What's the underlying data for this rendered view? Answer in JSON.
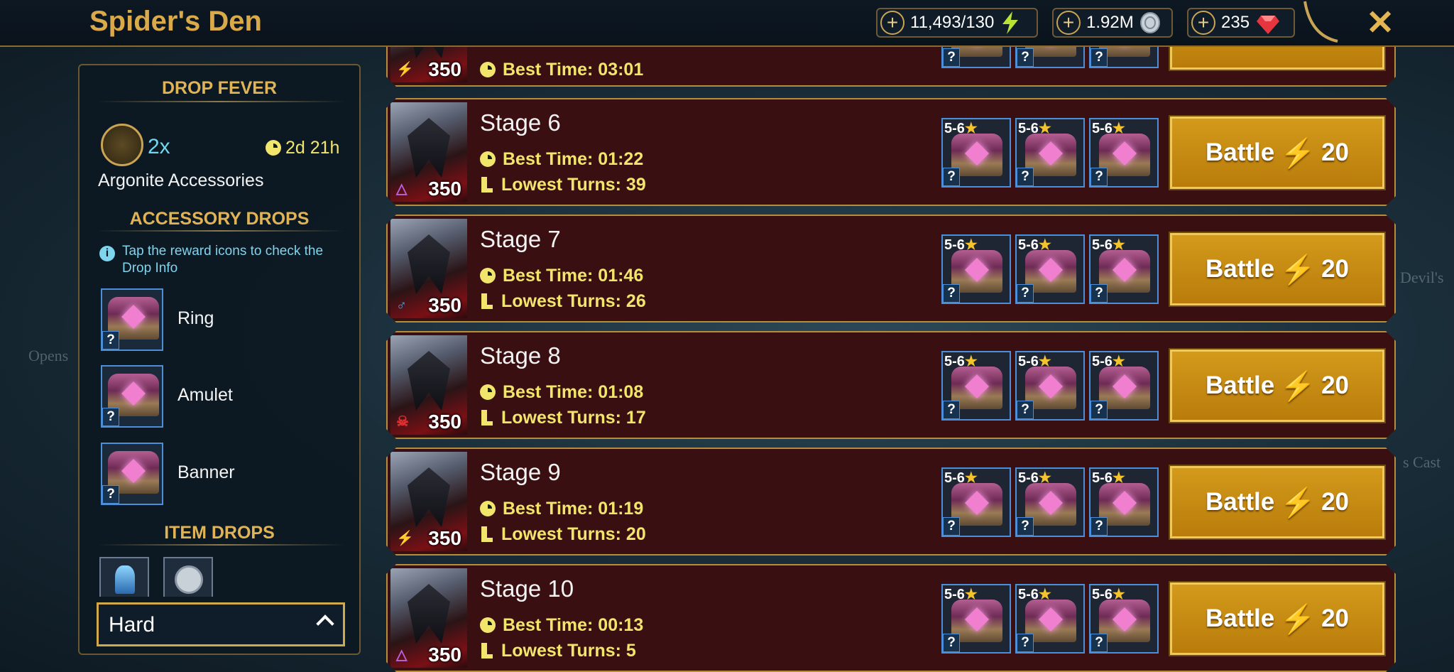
{
  "header": {
    "title": "Spider's Den",
    "energy": "11,493/130",
    "silver": "1.92M",
    "gems": "235",
    "close_icon": "close-icon"
  },
  "left_panel": {
    "drop_fever_title": "DROP FEVER",
    "multiplier": "2x",
    "timer": "2d 21h",
    "fever_item": "Argonite Accessories",
    "accessory_drops_title": "ACCESSORY DROPS",
    "info_text": "Tap the reward icons to check the Drop Info",
    "accessories": [
      {
        "name": "Ring",
        "q": "?"
      },
      {
        "name": "Amulet",
        "q": "?"
      },
      {
        "name": "Banner",
        "q": "?"
      }
    ],
    "item_drops_title": "ITEM DROPS",
    "difficulty": "Hard"
  },
  "stages": [
    {
      "name": "",
      "best_time": "Best Time: 03:01",
      "lowest_turns": "",
      "level": "350",
      "affinity": "⚡",
      "affinity_color": "#5fd35f"
    },
    {
      "name": "Stage 6",
      "best_time": "Best Time: 01:22",
      "lowest_turns": "Lowest Turns: 39",
      "level": "350",
      "affinity": "△",
      "affinity_color": "#c060e0"
    },
    {
      "name": "Stage 7",
      "best_time": "Best Time: 01:46",
      "lowest_turns": "Lowest Turns: 26",
      "level": "350",
      "affinity": "♂",
      "affinity_color": "#4aa0f0"
    },
    {
      "name": "Stage 8",
      "best_time": "Best Time: 01:08",
      "lowest_turns": "Lowest Turns: 17",
      "level": "350",
      "affinity": "☠",
      "affinity_color": "#e03030"
    },
    {
      "name": "Stage 9",
      "best_time": "Best Time: 01:19",
      "lowest_turns": "Lowest Turns: 20",
      "level": "350",
      "affinity": "⚡",
      "affinity_color": "#5fd35f"
    },
    {
      "name": "Stage 10",
      "best_time": "Best Time: 00:13",
      "lowest_turns": "Lowest Turns: 5",
      "level": "350",
      "affinity": "△",
      "affinity_color": "#c060e0"
    }
  ],
  "reward": {
    "rank": "5-6",
    "star": "★",
    "q": "?"
  },
  "battle": {
    "label": "Battle",
    "bolt": "⚡",
    "cost": "20"
  },
  "map_labels": [
    "Opens",
    "Devil's",
    "s Cast"
  ]
}
